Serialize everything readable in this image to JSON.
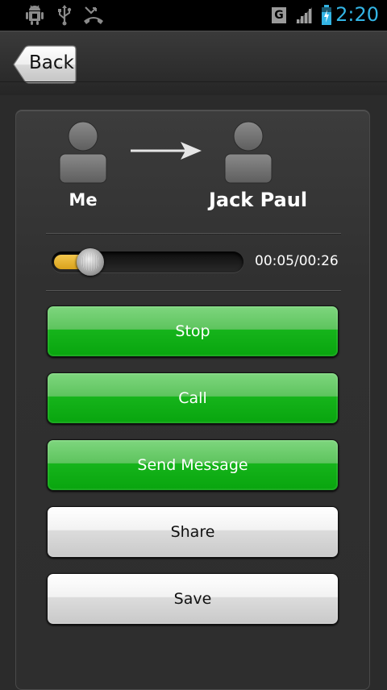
{
  "status_bar": {
    "time": "2:20",
    "network_label": "G",
    "icons": [
      "android-debug-icon",
      "usb-icon",
      "missed-call-icon",
      "signal-icon",
      "battery-icon"
    ]
  },
  "action_bar": {
    "back_label": "Back"
  },
  "call": {
    "from_name": "Me",
    "to_name": "Jack Paul"
  },
  "playback": {
    "progress": 0.192,
    "time_text": "00:05/00:26"
  },
  "buttons": {
    "stop": "Stop",
    "call": "Call",
    "send_message": "Send Message",
    "share": "Share",
    "save": "Save"
  },
  "colors": {
    "accent_blue": "#33b5e5",
    "green_button": "#0aa712",
    "progress_fill": "#e5b133"
  }
}
